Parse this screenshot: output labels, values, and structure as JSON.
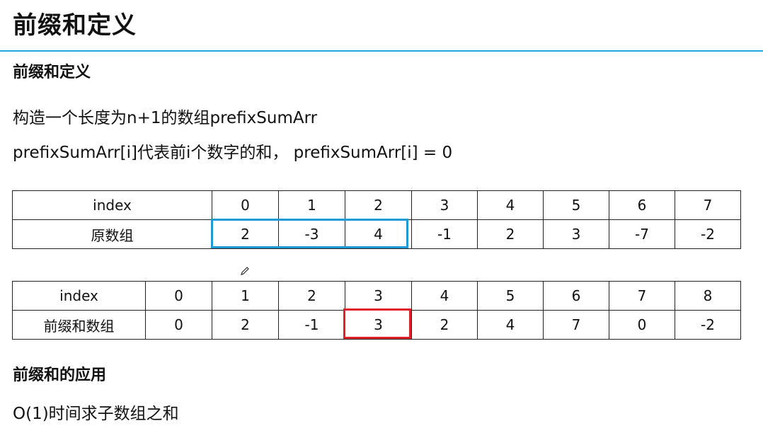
{
  "page_title": "前缀和定义",
  "section1": {
    "heading": "前缀和定义",
    "line1": "构造一个长度为n+1的数组prefixSumArr",
    "line2": "prefixSumArr[i]代表前i个数字的和， prefixSumArr[i] = 0"
  },
  "table1": {
    "rows": [
      [
        "index",
        "0",
        "1",
        "2",
        "3",
        "4",
        "5",
        "6",
        "7"
      ],
      [
        "原数组",
        "2",
        "-3",
        "4",
        "-1",
        "2",
        "3",
        "-7",
        "-2"
      ]
    ]
  },
  "table2": {
    "rows": [
      [
        "index",
        "0",
        "1",
        "2",
        "3",
        "4",
        "5",
        "6",
        "7",
        "8"
      ],
      [
        "前缀和数组",
        "0",
        "2",
        "-1",
        "3",
        "2",
        "4",
        "7",
        "0",
        "-2"
      ]
    ]
  },
  "section2": {
    "heading": "前缀和的应用",
    "line1": "O(1)时间求子数组之和"
  },
  "colors": {
    "rule": "#2aa7df",
    "highlight_blue": "#1f9ad6",
    "highlight_red": "#e0202a"
  },
  "icons": {
    "cursor": "pencil-icon"
  }
}
